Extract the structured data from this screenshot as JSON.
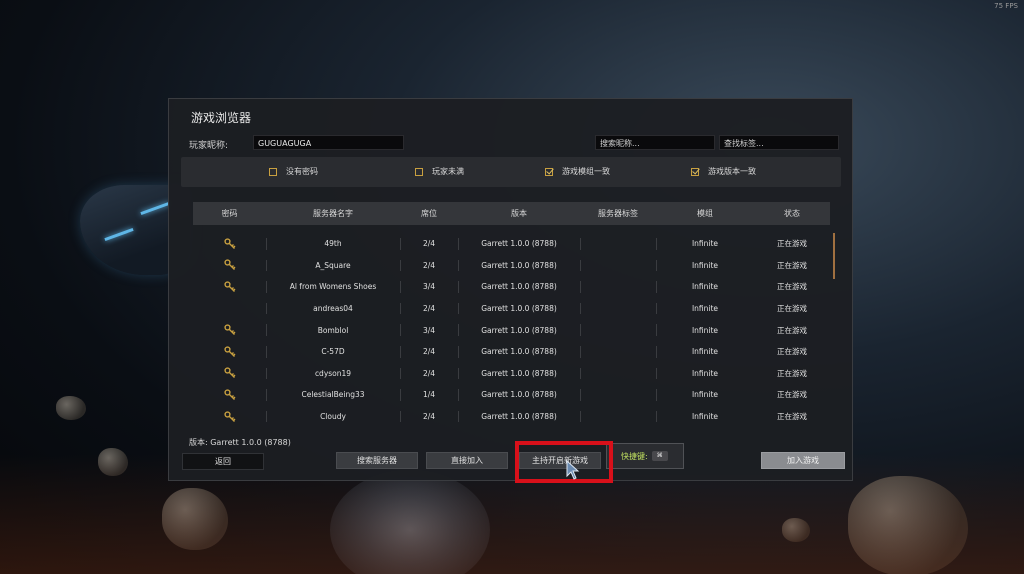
{
  "fps": "75 FPS",
  "title": "游戏浏览器",
  "nickname_label": "玩家昵称:",
  "nickname_value": "GUGUAGUGA",
  "search_nick_placeholder": "搜索昵称...",
  "search_tag_placeholder": "查找标签...",
  "filters": [
    {
      "label": "没有密码",
      "checked": false
    },
    {
      "label": "玩家未满",
      "checked": false
    },
    {
      "label": "游戏模组一致",
      "checked": true
    },
    {
      "label": "游戏版本一致",
      "checked": true
    }
  ],
  "columns": [
    "密码",
    "服务器名字",
    "席位",
    "版本",
    "服务器标签",
    "模组",
    "状态"
  ],
  "rows": [
    {
      "locked": true,
      "name": "49th",
      "seats": "2/4",
      "version": "Garrett 1.0.0 (8788)",
      "tags": "",
      "mod": "Infinite",
      "status": "正在游戏"
    },
    {
      "locked": true,
      "name": "A_Square",
      "seats": "2/4",
      "version": "Garrett 1.0.0 (8788)",
      "tags": "",
      "mod": "Infinite",
      "status": "正在游戏"
    },
    {
      "locked": true,
      "name": "Al from Womens Shoes",
      "seats": "3/4",
      "version": "Garrett 1.0.0 (8788)",
      "tags": "",
      "mod": "Infinite",
      "status": "正在游戏"
    },
    {
      "locked": false,
      "name": "andreas04",
      "seats": "2/4",
      "version": "Garrett 1.0.0 (8788)",
      "tags": "",
      "mod": "Infinite",
      "status": "正在游戏"
    },
    {
      "locked": true,
      "name": "Bomblol",
      "seats": "3/4",
      "version": "Garrett 1.0.0 (8788)",
      "tags": "",
      "mod": "Infinite",
      "status": "正在游戏"
    },
    {
      "locked": true,
      "name": "C-57D",
      "seats": "2/4",
      "version": "Garrett 1.0.0 (8788)",
      "tags": "",
      "mod": "Infinite",
      "status": "正在游戏"
    },
    {
      "locked": true,
      "name": "cdyson19",
      "seats": "2/4",
      "version": "Garrett 1.0.0 (8788)",
      "tags": "",
      "mod": "Infinite",
      "status": "正在游戏"
    },
    {
      "locked": true,
      "name": "CelestialBeing33",
      "seats": "1/4",
      "version": "Garrett 1.0.0 (8788)",
      "tags": "",
      "mod": "Infinite",
      "status": "正在游戏"
    },
    {
      "locked": true,
      "name": "Cloudy",
      "seats": "2/4",
      "version": "Garrett 1.0.0 (8788)",
      "tags": "",
      "mod": "Infinite",
      "status": "正在游戏"
    }
  ],
  "version_label": "版本: Garrett 1.0.0 (8788)",
  "buttons": {
    "back": "返回",
    "search_server": "搜索服务器",
    "direct_join": "直接加入",
    "host_new_game": "主持开启新游戏",
    "hotkey_label": "快捷键:",
    "join_game": "加入游戏"
  },
  "colors": {
    "accent_key": "#c8a040",
    "highlight": "#d8101a",
    "hotkey_text": "#c0e060"
  }
}
